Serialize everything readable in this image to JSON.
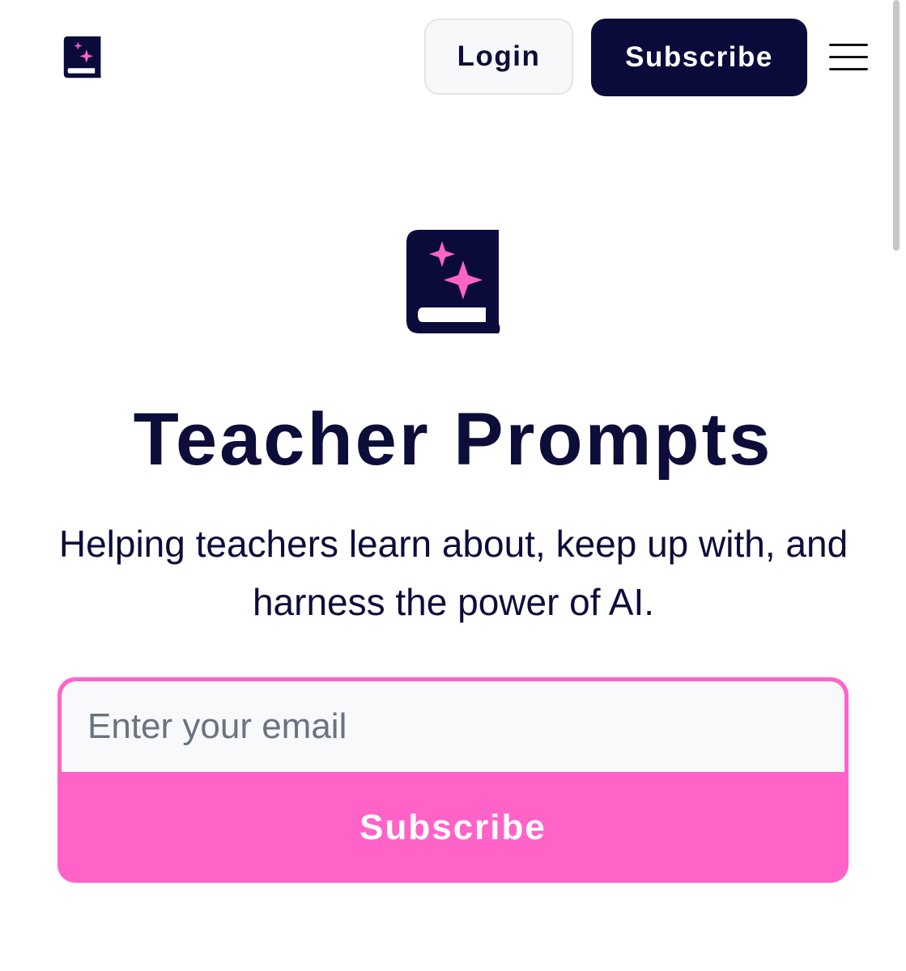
{
  "header": {
    "logo_icon": "book-sparkle-icon",
    "login_label": "Login",
    "subscribe_label": "Subscribe",
    "menu_icon": "hamburger-menu-icon"
  },
  "hero": {
    "logo_icon": "book-sparkle-icon",
    "title": "Teacher Prompts",
    "tagline": "Helping teachers learn about, keep up with, and harness the power of AI."
  },
  "signup": {
    "email_value": "",
    "email_placeholder": "Enter your email",
    "submit_label": "Subscribe"
  },
  "colors": {
    "navy": "#0b0b3b",
    "pink": "#ff63c8",
    "input_bg": "#f8f9fb"
  }
}
